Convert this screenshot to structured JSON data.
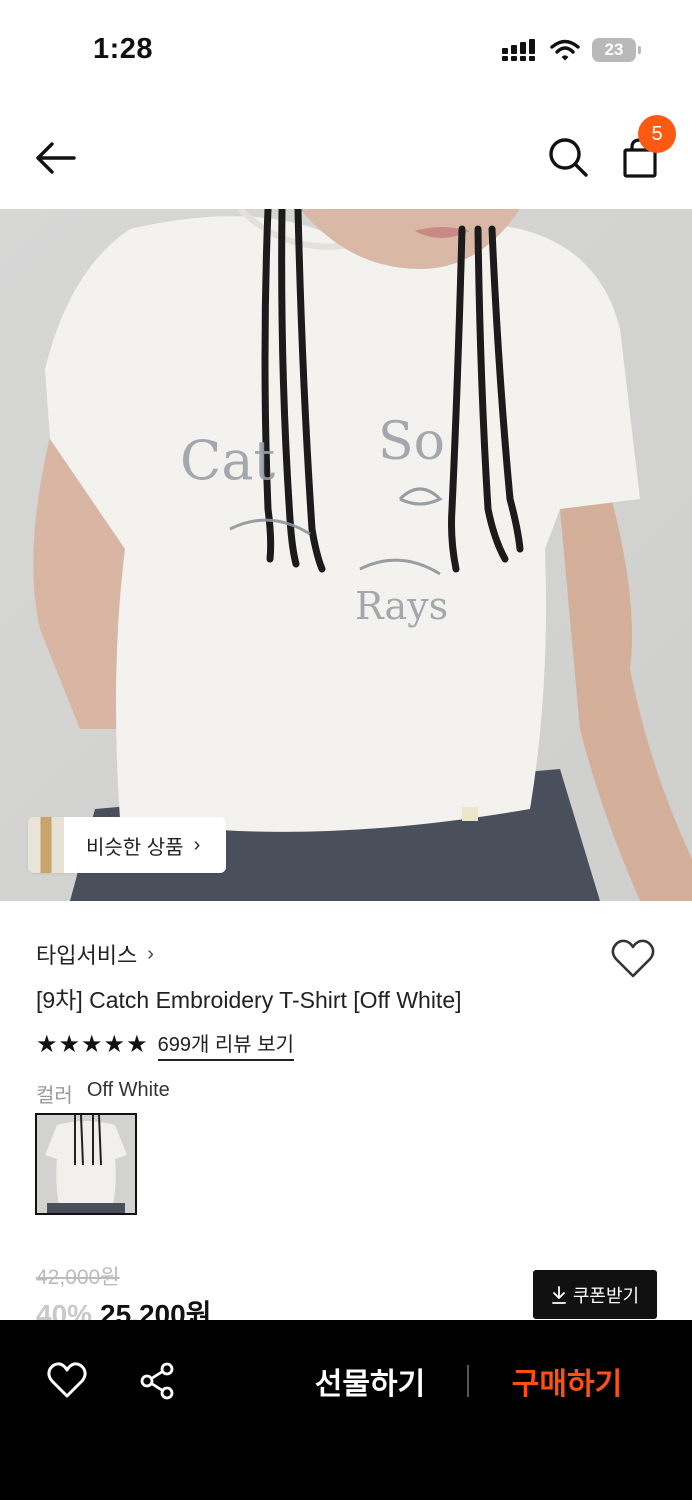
{
  "status_bar": {
    "time": "1:28",
    "battery": "23"
  },
  "nav": {
    "cart_count": "5"
  },
  "image": {
    "similar_label": "비슷한 상품"
  },
  "product": {
    "brand": "타입서비스",
    "title": "[9차] Catch Embroidery T-Shirt [Off White]",
    "rating_stars": 5,
    "review_link": "699개 리뷰 보기",
    "color_label": "컬러",
    "color_value": "Off White"
  },
  "price": {
    "original": "42,000원",
    "discount": "40%",
    "sale": "25,200원",
    "coupon_label": "쿠폰받기"
  },
  "bottom_bar": {
    "gift_label": "선물하기",
    "buy_label": "구매하기"
  },
  "colors": {
    "accent": "#ff5a14",
    "buy": "#ff4f12",
    "bar": "#000000"
  }
}
